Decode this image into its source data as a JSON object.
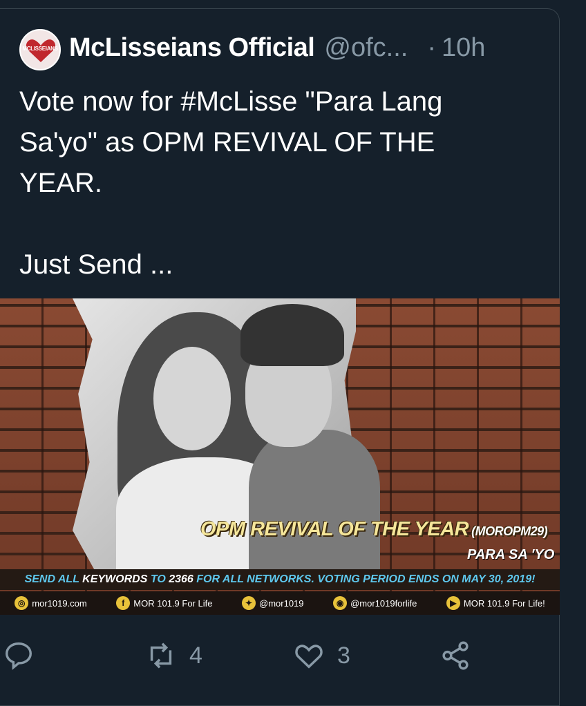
{
  "tweet": {
    "display_name": "McLisseians Official",
    "handle": "@ofc...",
    "separator": "·",
    "time": "10h",
    "avatar_text": "MCLISSEIANS",
    "text": "Vote now for #McLisse \"Para Lang\nSa'yo\" as OPM REVIVAL OF THE\nYEAR.\n\nJust Send ..."
  },
  "media": {
    "title": "OPM REVIVAL OF THE YEAR",
    "code": "(MOROPM29)",
    "subtitle": "PARA SA 'YO",
    "send_text_1": "SEND ALL",
    "send_text_2": "KEYWORDS",
    "send_text_3": "TO",
    "send_text_4": "2366",
    "send_text_5": "FOR ALL NETWORKS. VOTING PERIOD ENDS ON MAY 30, 2019!",
    "social": [
      {
        "icon": "globe-icon",
        "glyph": "◎",
        "label": "mor1019.com"
      },
      {
        "icon": "facebook-icon",
        "glyph": "f",
        "label": "MOR 101.9 For Life"
      },
      {
        "icon": "twitter-icon",
        "glyph": "✦",
        "label": "@mor1019"
      },
      {
        "icon": "instagram-icon",
        "glyph": "◉",
        "label": "@mor1019forlife"
      },
      {
        "icon": "youtube-icon",
        "glyph": "▶",
        "label": "MOR 101.9 For Life!"
      }
    ]
  },
  "actions": {
    "retweet_count": "4",
    "like_count": "3"
  },
  "colors": {
    "background": "#15202b",
    "secondary_text": "#8899a6",
    "border": "#38444d"
  }
}
